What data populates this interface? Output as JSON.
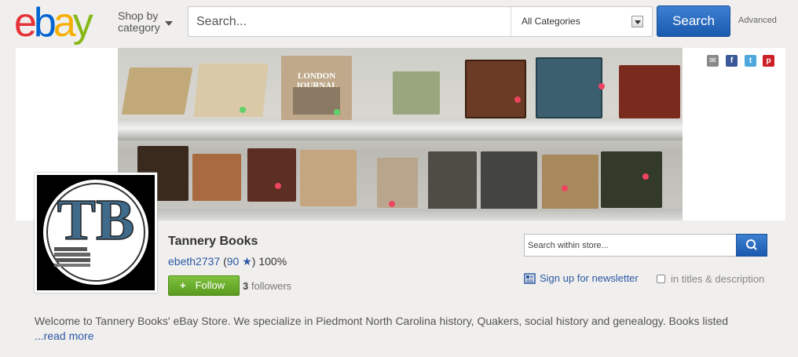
{
  "header": {
    "logo_letters": [
      "e",
      "b",
      "a",
      "y"
    ],
    "logo_colors": [
      "#e53238",
      "#0064d2",
      "#f5af02",
      "#86b817"
    ],
    "shop_by_line1": "Shop by",
    "shop_by_line2": "category",
    "search_placeholder": "Search...",
    "category_selected": "All Categories",
    "search_button": "Search",
    "advanced_link": "Advanced"
  },
  "banner": {
    "social_icons": [
      "email-icon",
      "facebook-icon",
      "twitter-icon",
      "pinterest-icon"
    ],
    "social_colors": [
      "#8a8a8a",
      "#3b5998",
      "#4ea8dd",
      "#cb2027"
    ],
    "book_title": "LONDON JOURNAL"
  },
  "store": {
    "logo_text": "TB",
    "name": "Tannery Books",
    "seller_id": "ebeth2737",
    "feedback_score": "90",
    "feedback_percent": "100%",
    "follow_label": "Follow",
    "follower_count": "3",
    "followers_label": "followers"
  },
  "store_search": {
    "placeholder": "Search within store...",
    "newsletter_label": "Sign up for newsletter",
    "titles_desc_label": "in titles & description"
  },
  "description": {
    "text": "Welcome to Tannery Books' eBay Store. We specialize in Piedmont North Carolina history, Quakers, social history and genealogy. Books listed",
    "read_more": "...read more"
  }
}
